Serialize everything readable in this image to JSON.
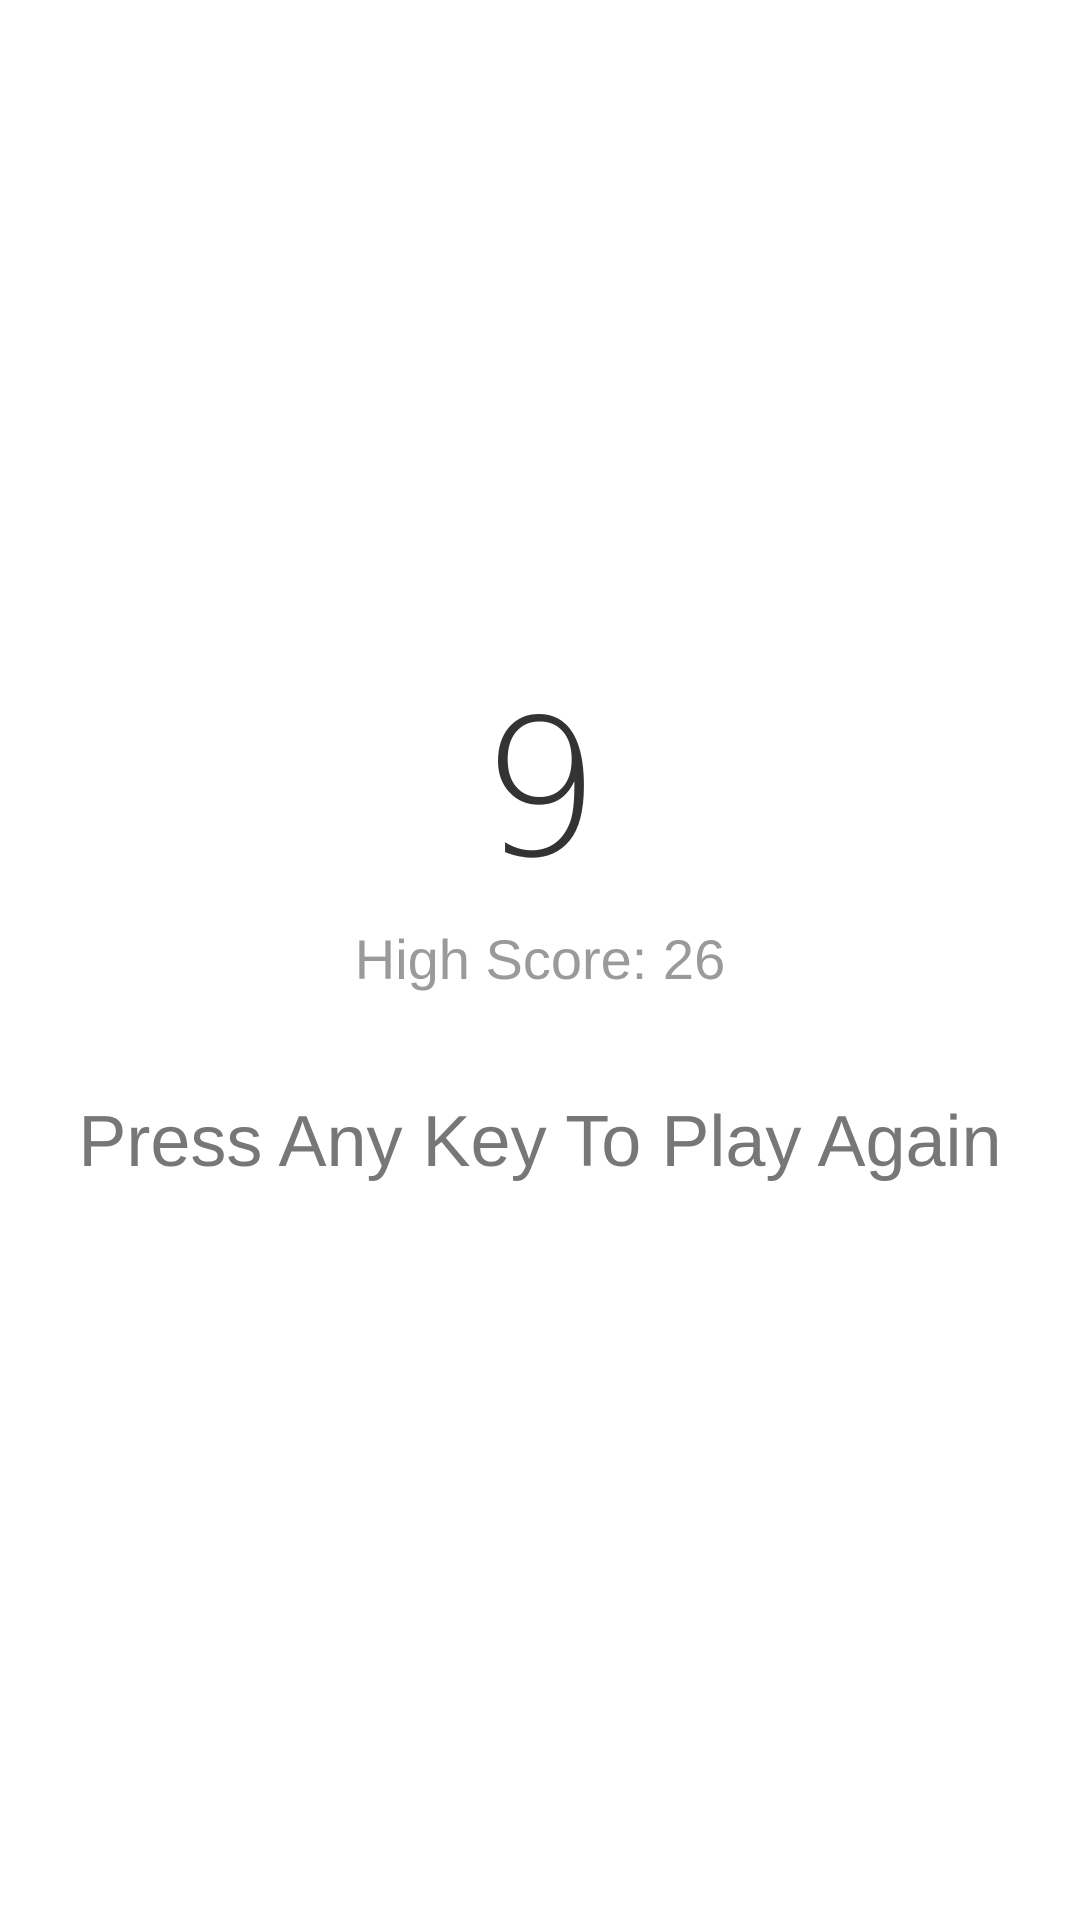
{
  "game": {
    "score": "9",
    "high_score_text": "High Score: 26",
    "prompt": "Press Any Key To Play Again"
  },
  "colors": {
    "background": "#ffffff",
    "score": "#333333",
    "high_score": "#9a9a9a",
    "prompt": "#777777"
  }
}
